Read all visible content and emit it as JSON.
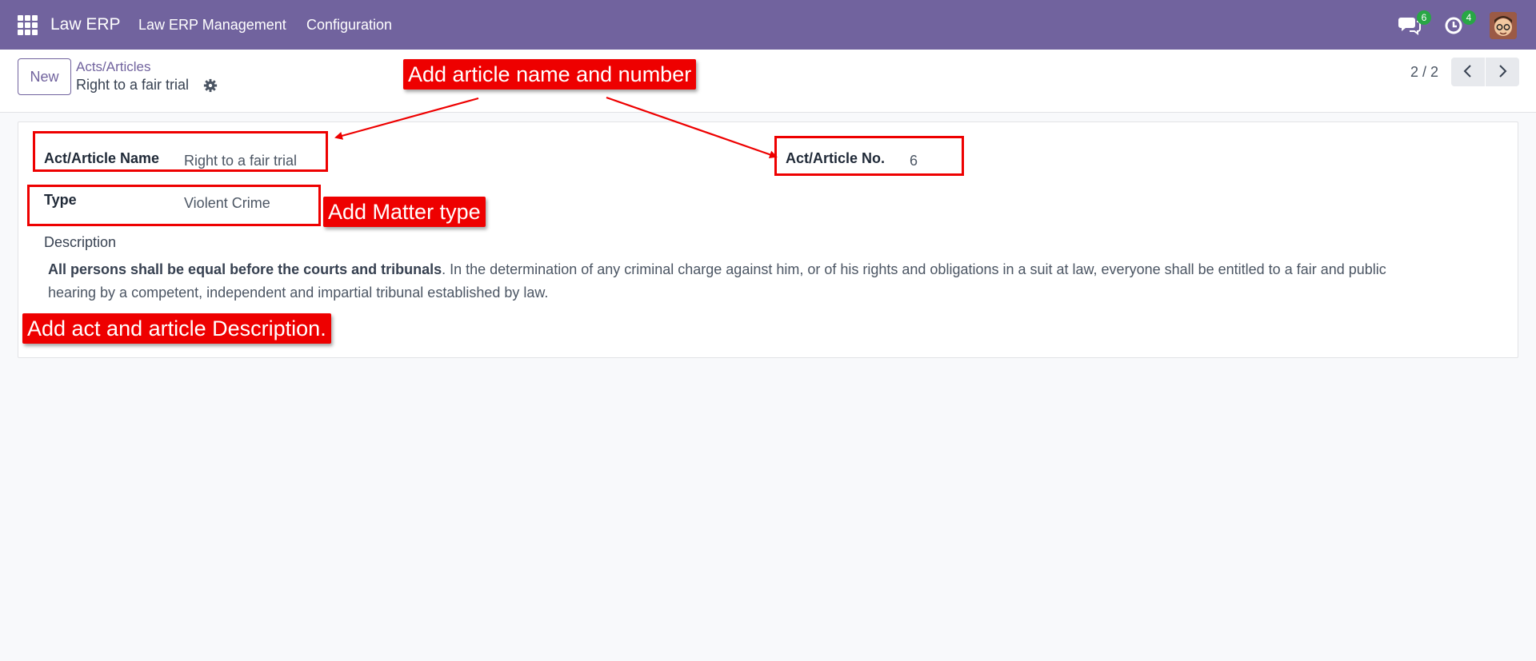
{
  "navbar": {
    "brand": "Law ERP",
    "menu": [
      "Law ERP Management",
      "Configuration"
    ],
    "messages_count": "6",
    "activities_count": "4"
  },
  "control_panel": {
    "new_label": "New",
    "breadcrumb": "Acts/Articles",
    "record_title": "Right to a fair trial",
    "pager": "2 / 2"
  },
  "form": {
    "name_label": "Act/Article Name",
    "name_value": "Right to a fair trial",
    "number_label": "Act/Article No.",
    "number_value": "6",
    "type_label": "Type",
    "type_value": "Violent Crime",
    "description_label": "Description",
    "description_bold": "All persons shall be equal before the courts and tribunals",
    "description_rest": ". In the determination of any criminal charge against him, or of his rights and obligations in a suit at law, everyone shall be entitled to a fair and public hearing by a competent, independent and impartial tribunal established by law."
  },
  "annotations": {
    "name_number": "Add article name and number",
    "matter_type": "Add Matter type",
    "description": "Add act and article Description."
  },
  "colors": {
    "navbar": "#71639e",
    "annotation": "#ee0000",
    "badge": "#28a745"
  }
}
